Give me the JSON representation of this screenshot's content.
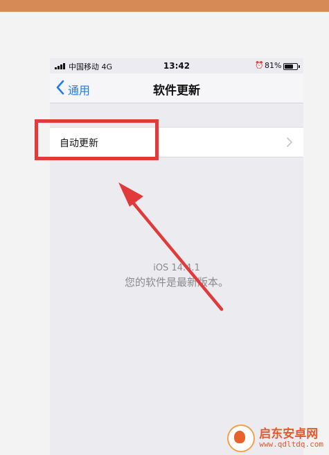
{
  "status_bar": {
    "carrier": "中国移动 4G",
    "time": "13:42",
    "battery": "81%",
    "battery_level": 0.81
  },
  "nav": {
    "back_label": "通用",
    "title": "软件更新"
  },
  "list": {
    "auto_update_label": "自动更新"
  },
  "info": {
    "version": "iOS 14.4.1",
    "message": "您的软件是最新版本。"
  },
  "watermark": {
    "name": "启东安卓网",
    "url": "www.qdltdq.com"
  },
  "colors": {
    "banner": "#d68b57",
    "accent": "#1f7af0",
    "annotation": "#e03a3a"
  },
  "icons": {
    "back": "chevron-left-icon",
    "row": "chevron-right-icon",
    "alarm": "alarm-icon"
  }
}
